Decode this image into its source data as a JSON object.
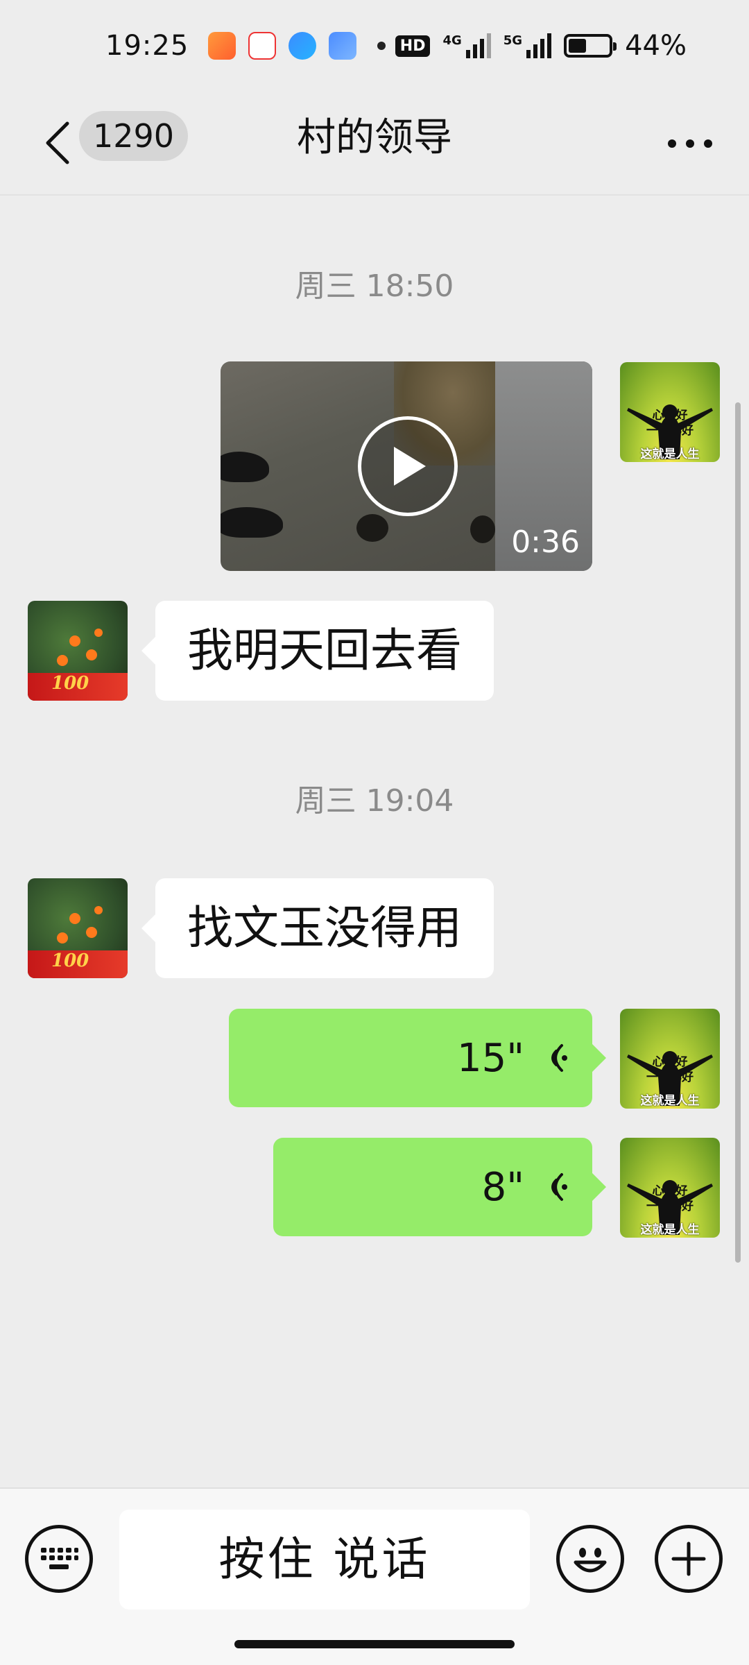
{
  "status": {
    "time": "19:25",
    "hd_badge": "HD",
    "net1": "4G",
    "net2": "5G",
    "battery_text": "44%",
    "battery_level": 0.44
  },
  "nav": {
    "unread_count": "1290",
    "title": "村的领导"
  },
  "messages": {
    "time1": "周三 18:50",
    "video_duration": "0:36",
    "text1": "我明天回去看",
    "time2": "周三 19:04",
    "text2": "找文玉没得用",
    "voice1_duration": "15\"",
    "voice2_duration": "8\""
  },
  "avatars": {
    "me_line1": "心态好",
    "me_line2": "一切都好",
    "me_line3": "这就是人生",
    "other_badge": "100"
  },
  "input_bar": {
    "talk_label": "按住 说话"
  },
  "colors": {
    "voice_bubble": "#95ec69",
    "background": "#ededed"
  }
}
